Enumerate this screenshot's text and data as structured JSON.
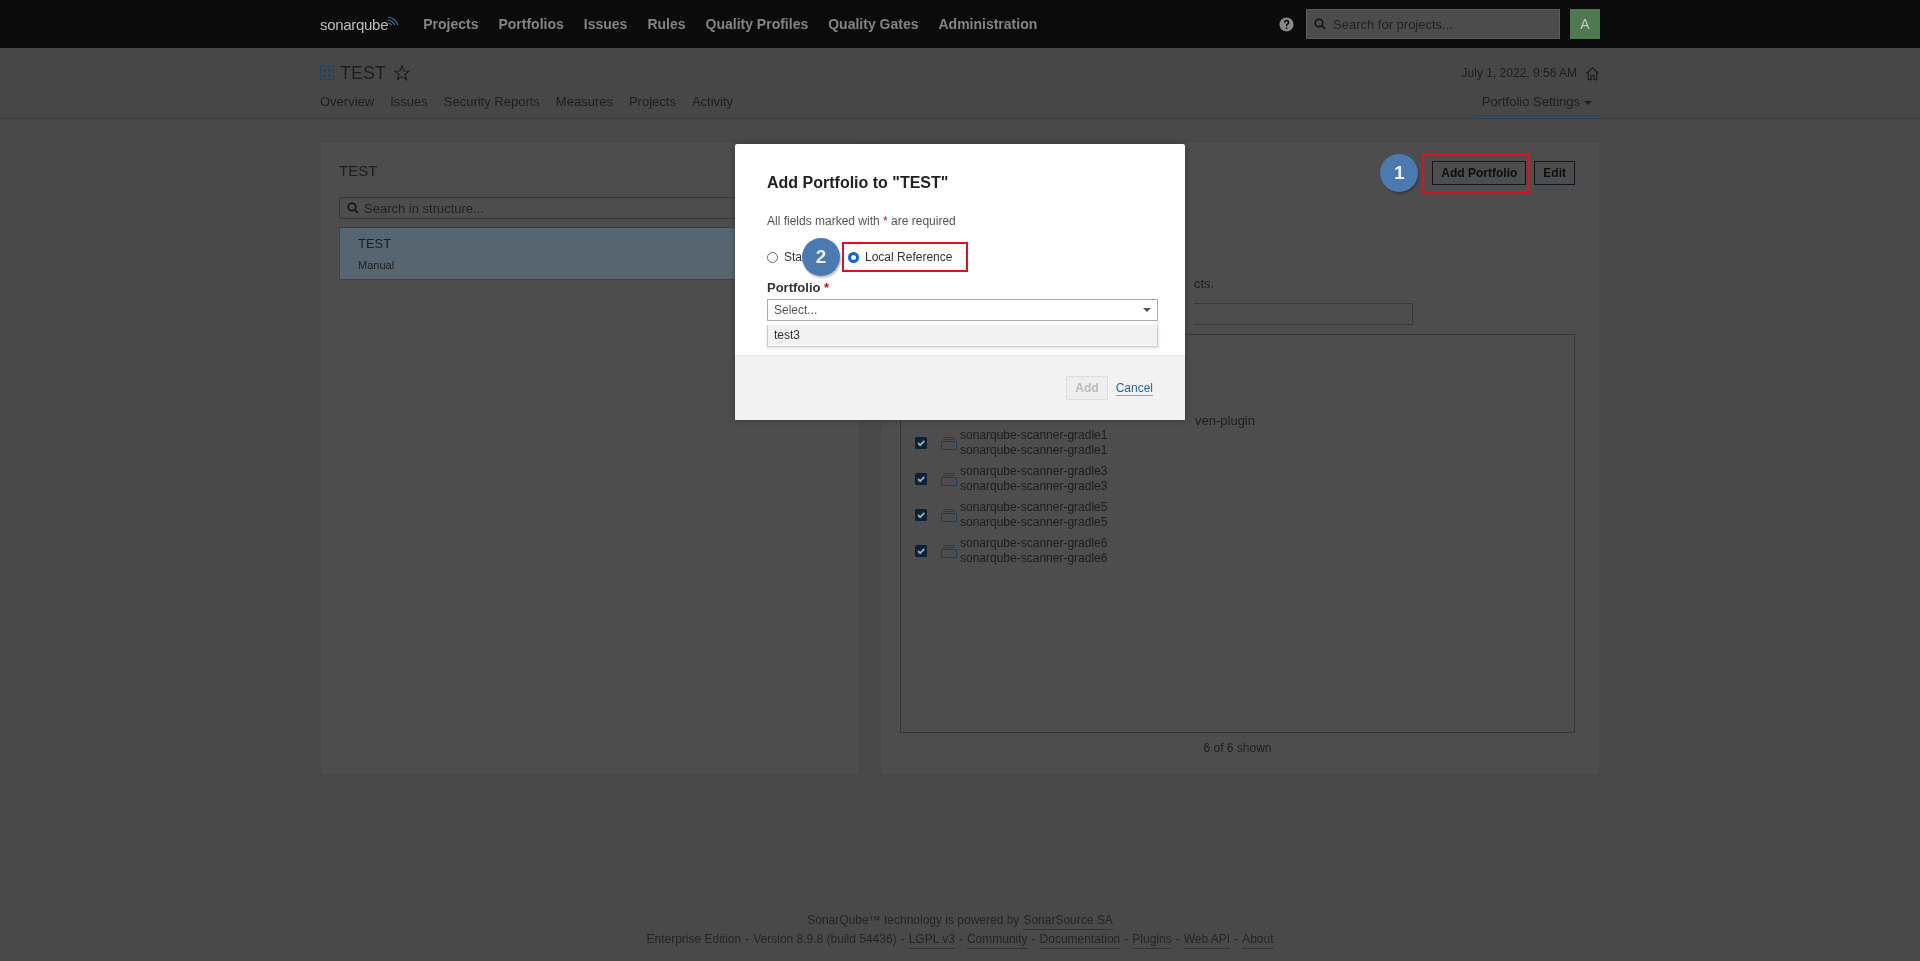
{
  "top_bar": {
    "logo": "sonar**qube**",
    "nav": [
      {
        "label": "Projects"
      },
      {
        "label": "Portfolios"
      },
      {
        "label": "Issues"
      },
      {
        "label": "Rules"
      },
      {
        "label": "Quality Profiles"
      },
      {
        "label": "Quality Gates"
      },
      {
        "label": "Administration"
      }
    ],
    "search": {
      "placeholder": "Search for projects..."
    },
    "avatar": "A"
  },
  "header": {
    "title": "TEST",
    "date": "July 1, 2022, 9:56 AM",
    "tabs": [
      {
        "label": "Overview",
        "selected": false
      },
      {
        "label": "Issues",
        "selected": false
      },
      {
        "label": "Security Reports",
        "selected": false
      },
      {
        "label": "Measures",
        "selected": false
      },
      {
        "label": "Projects",
        "selected": false
      },
      {
        "label": "Activity",
        "selected": false
      }
    ],
    "settings": {
      "label": "Portfolio Settings",
      "selected": true
    }
  },
  "structure": {
    "title": "TEST",
    "search": {
      "placeholder": "Search in structure..."
    },
    "items": [
      {
        "name": "TEST",
        "type": "Manual",
        "selected": true
      }
    ]
  },
  "details": {
    "callout": "1",
    "buttons": [
      "Add Portfolio",
      "Edit"
    ],
    "text_fragment": "cts.",
    "list_fragment": "ven-plugin",
    "projects": [
      {
        "name": "sonarqube-scanner-gradle1",
        "key": "sonarqube-scanner-gradle1",
        "checked": true
      },
      {
        "name": "sonarqube-scanner-gradle3",
        "key": "sonarqube-scanner-gradle3",
        "checked": true
      },
      {
        "name": "sonarqube-scanner-gradle5",
        "key": "sonarqube-scanner-gradle5",
        "checked": true
      },
      {
        "name": "sonarqube-scanner-gradle6",
        "key": "sonarqube-scanner-gradle6",
        "checked": true
      }
    ],
    "count": "6 of 6 shown"
  },
  "modal": {
    "title": "Add Portfolio to \"TEST\"",
    "note_before": "All fields marked with",
    "note_mark": "*",
    "note_after": "are required",
    "callout": "2",
    "options": [
      {
        "label": "Sta",
        "selected": false
      },
      {
        "label": "Local Reference",
        "selected": true
      }
    ],
    "field_label": "Portfolio",
    "field_mark": "*",
    "select": {
      "placeholder": "Select...",
      "options": [
        "test3"
      ]
    },
    "buttons": [
      {
        "label": "Add",
        "kind": "button",
        "disabled": true
      },
      {
        "label": "Cancel",
        "kind": "link",
        "disabled": false
      }
    ]
  },
  "footer": {
    "line_1": [
      {
        "text": "SonarQube™ technology is powered by",
        "kind": "text"
      },
      {
        "text": "SonarSource SA",
        "kind": "link"
      }
    ],
    "line_2": [
      {
        "text": "Enterprise Edition",
        "kind": "text"
      },
      {
        "text": "-",
        "kind": "sep"
      },
      {
        "text": "Version 8.9.8 (build 54436)",
        "kind": "text"
      },
      {
        "text": "-",
        "kind": "sep"
      },
      {
        "text": "LGPL v3",
        "kind": "link"
      },
      {
        "text": "-",
        "kind": "sep"
      },
      {
        "text": "Community",
        "kind": "link"
      },
      {
        "text": "-",
        "kind": "sep"
      },
      {
        "text": "Documentation",
        "kind": "link"
      },
      {
        "text": "-",
        "kind": "sep"
      },
      {
        "text": "Plugins",
        "kind": "link"
      },
      {
        "text": "-",
        "kind": "sep"
      },
      {
        "text": "Web API",
        "kind": "link"
      },
      {
        "text": "-",
        "kind": "sep"
      },
      {
        "text": "About",
        "kind": "link"
      }
    ]
  }
}
